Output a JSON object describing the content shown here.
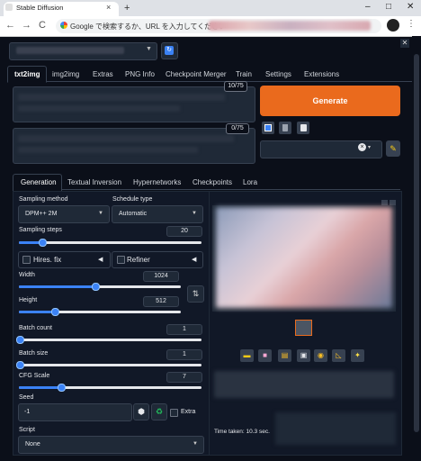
{
  "browser": {
    "tab_title": "Stable Diffusion",
    "tab_close": "×",
    "new_tab": "+",
    "window_controls": [
      "–",
      "□",
      "✕"
    ],
    "nav": {
      "back": "←",
      "forward": "→",
      "reload": "C"
    },
    "address_placeholder": "Google で検索するか、URL を入力してください",
    "menu": "⋮"
  },
  "header": {
    "refresh_icon": "↻",
    "close_icon": "✕"
  },
  "main_tabs": [
    "txt2img",
    "img2img",
    "Extras",
    "PNG Info",
    "Checkpoint Merger",
    "Train",
    "Settings",
    "Extensions"
  ],
  "prompt": {
    "counter": "10/75"
  },
  "negative_prompt": {
    "counter": "0/75"
  },
  "generate": {
    "label": "Generate"
  },
  "styles": {
    "clear": "×",
    "arrow": "▾"
  },
  "sub_tabs": [
    "Generation",
    "Textual Inversion",
    "Hypernetworks",
    "Checkpoints",
    "Lora"
  ],
  "generation": {
    "sampling_method": {
      "label": "Sampling method",
      "value": "DPM++ 2M"
    },
    "schedule_type": {
      "label": "Schedule type",
      "value": "Automatic"
    },
    "sampling_steps": {
      "label": "Sampling steps",
      "value": "20",
      "fraction": 0.13
    },
    "hires_fix": {
      "label": "Hires. fix",
      "arrow": "◀"
    },
    "refiner": {
      "label": "Refiner",
      "arrow": "◀"
    },
    "width": {
      "label": "Width",
      "value": "1024",
      "fraction": 0.47
    },
    "height": {
      "label": "Height",
      "value": "512",
      "fraction": 0.22
    },
    "swap": "⇅",
    "batch_count": {
      "label": "Batch count",
      "value": "1"
    },
    "batch_size": {
      "label": "Batch size",
      "value": "1"
    },
    "cfg_scale": {
      "label": "CFG Scale",
      "value": "7",
      "fraction": 0.23
    },
    "seed": {
      "label": "Seed",
      "value": "-1"
    },
    "extra": {
      "label": "Extra"
    },
    "script": {
      "label": "Script",
      "value": "None"
    }
  },
  "output": {
    "time_taken": "Time taken: 10.3 sec."
  }
}
